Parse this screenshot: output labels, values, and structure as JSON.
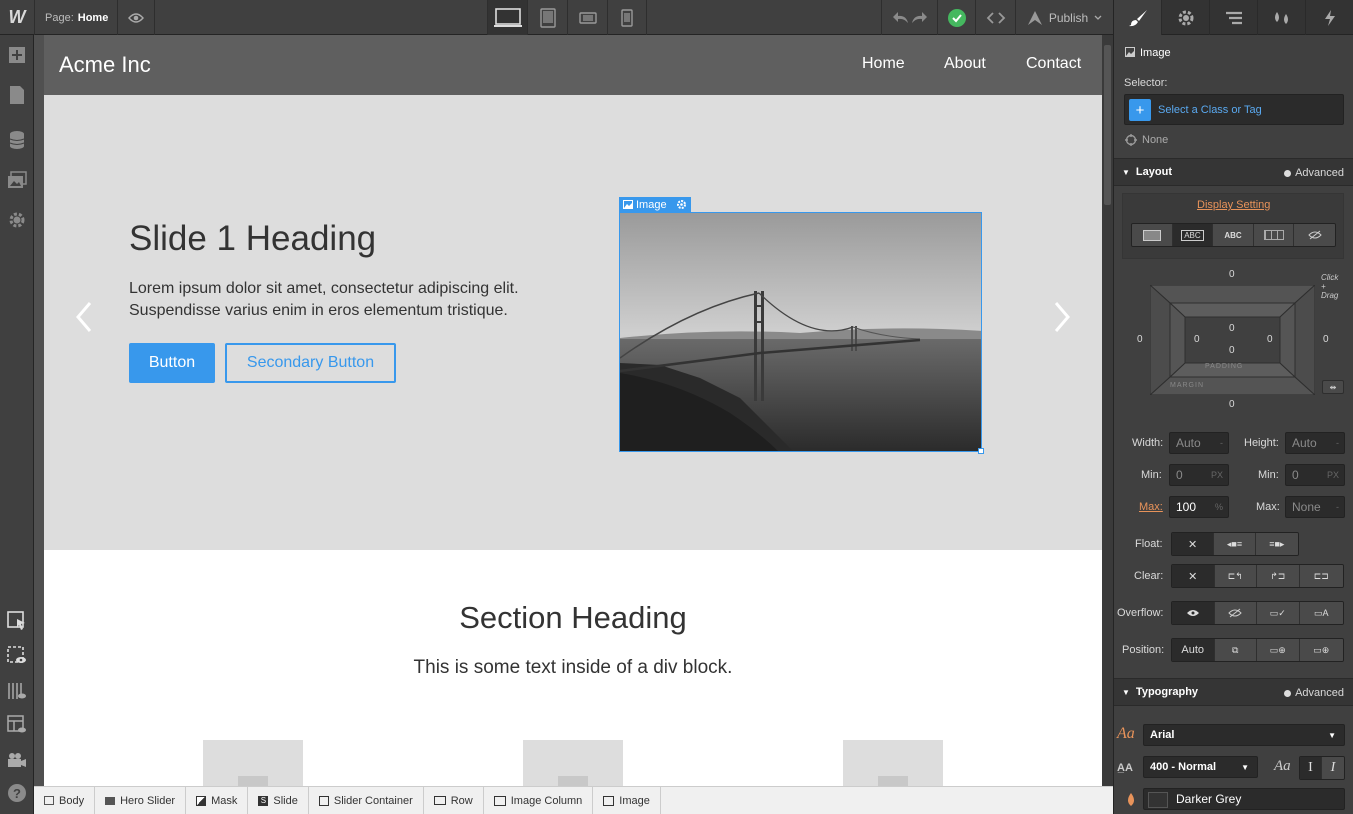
{
  "topbar": {
    "logo": "W",
    "page_label": "Page:",
    "page_name": "Home",
    "publish_label": "Publish"
  },
  "site": {
    "brand": "Acme Inc",
    "nav": [
      "Home",
      "About",
      "Contact"
    ],
    "hero": {
      "heading": "Slide 1 Heading",
      "paragraph": "Lorem ipsum dolor sit amet, consectetur adipiscing elit. Suspendisse varius enim in eros elementum tristique.",
      "button_primary": "Button",
      "button_secondary": "Secondary Button",
      "image_tag": "Image"
    },
    "section": {
      "heading": "Section Heading",
      "text": "This is some text inside of a div block."
    }
  },
  "breadcrumbs": [
    "Body",
    "Hero Slider",
    "Mask",
    "Slide",
    "Slider Container",
    "Row",
    "Image Column",
    "Image"
  ],
  "panel": {
    "element_type": "Image",
    "selector_label": "Selector:",
    "selector_placeholder": "Select a Class or Tag",
    "selector_state": "None",
    "layout_title": "Layout",
    "advanced_label": "Advanced",
    "display_setting": "Display Setting",
    "display_abc1": "ABC",
    "display_abc2": "ABC",
    "box": {
      "margin_top": "0",
      "margin_left": "0",
      "margin_right": "0",
      "margin_bottom": "0",
      "padding_top": "0",
      "padding_left": "0",
      "padding_right": "0",
      "padding_bottom": "0",
      "center": "0",
      "padding_label": "PADDING",
      "margin_label": "MARGIN",
      "hint": "Click + Drag"
    },
    "width_label": "Width:",
    "width_value": "Auto",
    "height_label": "Height:",
    "height_value": "Auto",
    "min_label": "Min:",
    "min_w": "0",
    "min_h": "0",
    "unit_px": "PX",
    "max_label": "Max:",
    "max_w": "100",
    "max_w_unit": "%",
    "max_h": "None",
    "dash": "-",
    "float_label": "Float:",
    "clear_label": "Clear:",
    "overflow_label": "Overflow:",
    "position_label": "Position:",
    "position_auto": "Auto",
    "typography_title": "Typography",
    "font_family": "Arial",
    "font_weight": "400 - Normal",
    "font_color": "Darker Grey",
    "aa": "Aa"
  },
  "colors": {
    "accent": "#3898ec",
    "nav_bg": "#5f5f5f",
    "hero_bg": "#dddddd",
    "panel_bg": "#404040",
    "publish_check": "#45b85f",
    "max_highlight": "#e8935a"
  }
}
